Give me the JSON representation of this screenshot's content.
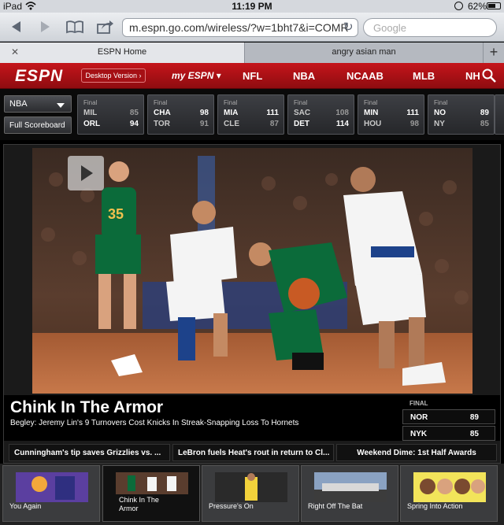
{
  "status_bar": {
    "carrier": "iPad",
    "time": "11:19 PM",
    "battery": "62%",
    "battery_level": 0.62
  },
  "browser": {
    "url": "m.espn.go.com/wireless/?w=1bht7&i=COMR",
    "search_placeholder": "Google",
    "tabs": [
      {
        "title": "ESPN Home",
        "active": true
      },
      {
        "title": "angry asian man",
        "active": false
      }
    ],
    "new_tab": "+"
  },
  "espn_nav": {
    "logo": "ESPN",
    "desktop_version": "Desktop Version ›",
    "my_espn": "my ESPN",
    "links": [
      "NFL",
      "NBA",
      "NCAAB",
      "MLB",
      "NH"
    ]
  },
  "scoreboard": {
    "league": "NBA",
    "full_scoreboard": "Full Scoreboard",
    "games": [
      {
        "status": "Final",
        "away": "MIL",
        "away_score": "85",
        "home": "ORL",
        "home_score": "94",
        "winner": "home"
      },
      {
        "status": "Final",
        "away": "CHA",
        "away_score": "98",
        "home": "TOR",
        "home_score": "91",
        "winner": "away"
      },
      {
        "status": "Final",
        "away": "MIA",
        "away_score": "111",
        "home": "CLE",
        "home_score": "87",
        "winner": "away"
      },
      {
        "status": "Final",
        "away": "SAC",
        "away_score": "108",
        "home": "DET",
        "home_score": "114",
        "winner": "home"
      },
      {
        "status": "Final",
        "away": "MIN",
        "away_score": "111",
        "home": "HOU",
        "home_score": "98",
        "winner": "away"
      },
      {
        "status": "Final",
        "away": "NO",
        "away_score": "89",
        "home": "NY",
        "home_score": "85",
        "winner": "away"
      }
    ]
  },
  "hero": {
    "headline": "Chink In The Armor",
    "subhead": "Begley: Jeremy Lin's 9 Turnovers Cost Knicks In Streak-Snapping Loss To Hornets",
    "final_label": "FINAL",
    "final": [
      {
        "team": "NOR",
        "score": "89"
      },
      {
        "team": "NYK",
        "score": "85"
      }
    ],
    "links": [
      "Cunningham's tip saves Grizzlies vs. ...",
      "LeBron fuels Heat's rout in return to Cl...",
      "Weekend Dime: 1st Half Awards"
    ]
  },
  "thumbnails": [
    {
      "label": "You Again",
      "active": false
    },
    {
      "label": "Chink In The Armor",
      "active": true
    },
    {
      "label": "Pressure's On",
      "active": false
    },
    {
      "label": "Right Off The Bat",
      "active": false
    },
    {
      "label": "Spring Into Action",
      "active": false
    }
  ],
  "colors": {
    "espn_red": "#c5151b",
    "knicks_orange": "#f26522",
    "knicks_blue": "#1d428a",
    "celtic_green": "#0b6b3a"
  }
}
